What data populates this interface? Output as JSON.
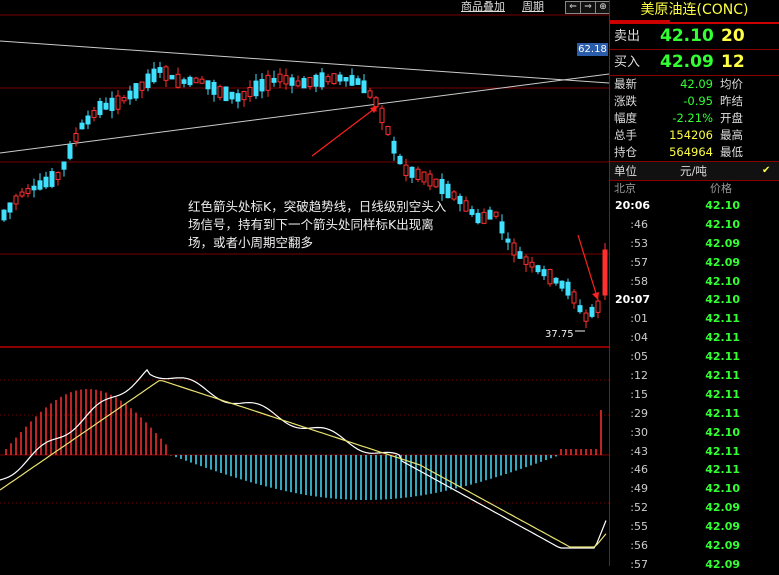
{
  "toolbar": {
    "overlay_label": "商品叠加",
    "period_label": "周期",
    "nav_prev": "⇐",
    "nav_next": "⇒",
    "nav_last": "⊕"
  },
  "chart": {
    "current_price_tag": "62.18",
    "low_label": "37.75",
    "annotation": "红色箭头处标K，突破趋势线，日线级别空头入场信号，持有到下一个箭头处同样标K出现离场，或者小周期空翻多",
    "colors": {
      "up": "#ff3030",
      "down": "#40e0ff",
      "grid": "#7a0000",
      "dif": "#ffffff",
      "dea": "#e8e070"
    }
  },
  "panel": {
    "title": "美原油连(CONC)",
    "sell": {
      "label": "卖出",
      "price": "42.10",
      "volume": "20"
    },
    "buy": {
      "label": "买入",
      "price": "42.09",
      "volume": "12"
    },
    "stats": [
      {
        "label": "最新",
        "value": "42.09",
        "right": "均价",
        "color": "green"
      },
      {
        "label": "涨跌",
        "value": "-0.95",
        "right": "昨结",
        "color": "green"
      },
      {
        "label": "幅度",
        "value": "-2.21%",
        "right": "开盘",
        "color": "green"
      },
      {
        "label": "总手",
        "value": "154206",
        "right": "最高",
        "color": "yellow"
      },
      {
        "label": "持仓",
        "value": "564964",
        "right": "最低",
        "color": "yellow"
      }
    ],
    "unit_label": "单位",
    "unit_value": "元/吨",
    "location": "北京",
    "price_header": "价格",
    "ticks": [
      {
        "time": "20:06",
        "price": "42.10",
        "full": true
      },
      {
        "time": ":46",
        "price": "42.10"
      },
      {
        "time": ":53",
        "price": "42.09"
      },
      {
        "time": ":57",
        "price": "42.09"
      },
      {
        "time": ":58",
        "price": "42.10"
      },
      {
        "time": "20:07",
        "price": "42.10",
        "full": true
      },
      {
        "time": ":01",
        "price": "42.11"
      },
      {
        "time": ":04",
        "price": "42.11"
      },
      {
        "time": ":05",
        "price": "42.11"
      },
      {
        "time": ":12",
        "price": "42.11"
      },
      {
        "time": ":15",
        "price": "42.11"
      },
      {
        "time": ":29",
        "price": "42.11"
      },
      {
        "time": ":30",
        "price": "42.10"
      },
      {
        "time": ":43",
        "price": "42.11"
      },
      {
        "time": ":46",
        "price": "42.11"
      },
      {
        "time": ":49",
        "price": "42.10"
      },
      {
        "time": ":52",
        "price": "42.09"
      },
      {
        "time": ":55",
        "price": "42.09"
      },
      {
        "time": ":56",
        "price": "42.09"
      },
      {
        "time": ":57",
        "price": "42.09"
      }
    ]
  }
}
